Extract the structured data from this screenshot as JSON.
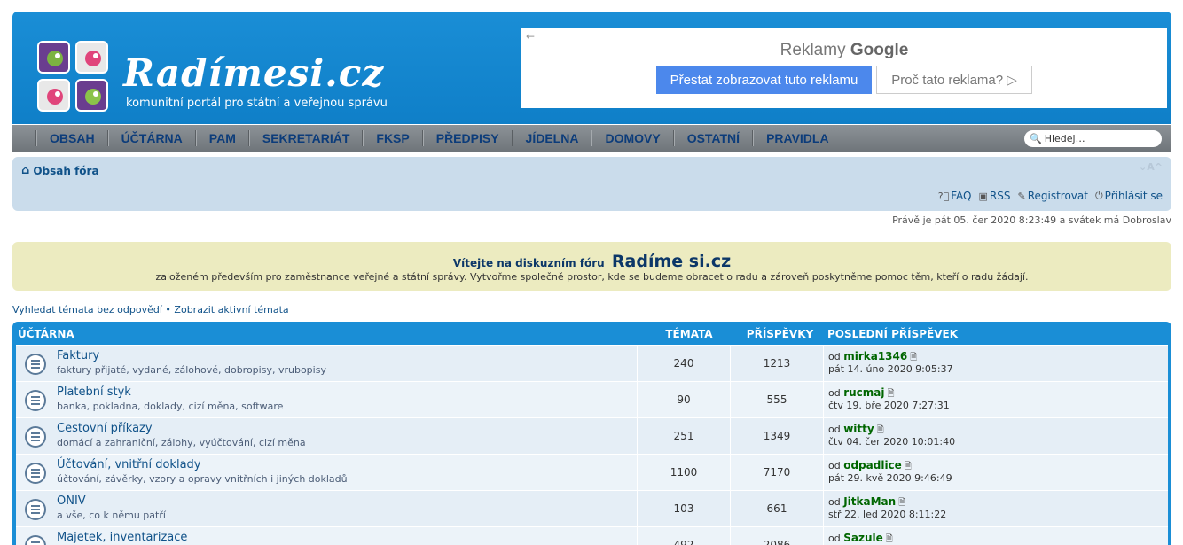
{
  "header": {
    "logo_title": "Radímesi.cz",
    "logo_subtitle": "komunitní portál pro státní a veřejnou správu"
  },
  "ad": {
    "back": "←",
    "title_prefix": "Reklamy",
    "title_brand": "Google",
    "stop_button": "Přestat zobrazovat tuto reklamu",
    "why_button": "Proč tato reklama? ▷"
  },
  "nav": {
    "items": [
      "OBSAH",
      "ÚČTÁRNA",
      "PAM",
      "SEKRETARIÁT",
      "FKSP",
      "PŘEDPISY",
      "JÍDELNA",
      "DOMOVY",
      "OSTATNÍ",
      "PRAVIDLA"
    ],
    "search_placeholder": "Hledej…"
  },
  "breadcrumb": {
    "home": "Obsah fóra",
    "font_size": "⌄A^",
    "links": {
      "faq": "FAQ",
      "rss": "RSS",
      "register": "Registrovat",
      "login": "Přihlásit se"
    }
  },
  "datetime": "Právě je pát 05. čer 2020 8:23:49 a svátek má Dobroslav",
  "welcome": {
    "line1_prefix": "Vítejte na diskuzním fóru",
    "line1_big": "Radíme si.cz",
    "line2": "založeném především pro zaměstnance veřejné a státní správy. Vytvořme společně prostor, kde se budeme obracet o radu a zároveň poskytněme pomoc těm, kteří o radu žádají."
  },
  "quicklinks": {
    "unanswered": "Vyhledat témata bez odpovědí",
    "sep": "•",
    "active": "Zobrazit aktivní témata"
  },
  "forum": {
    "title": "ÚČTÁRNA",
    "col_topics": "TÉMATA",
    "col_posts": "PŘÍSPĚVKY",
    "col_last": "POSLEDNÍ PŘÍSPĚVEK",
    "by_prefix": "od",
    "rows": [
      {
        "name": "Faktury",
        "desc": "faktury přijaté, vydané, zálohové, dobropisy, vrubopisy",
        "topics": "240",
        "posts": "1213",
        "user": "mirka1346",
        "when": "pát 14. úno 2020 9:05:37"
      },
      {
        "name": "Platební styk",
        "desc": "banka, pokladna, doklady, cizí měna, software",
        "topics": "90",
        "posts": "555",
        "user": "rucmaj",
        "when": "čtv 19. bře 2020 7:27:31"
      },
      {
        "name": "Cestovní příkazy",
        "desc": "domácí a zahraniční, zálohy, vyúčtování, cizí měna",
        "topics": "251",
        "posts": "1349",
        "user": "witty",
        "when": "čtv 04. čer 2020 10:01:40"
      },
      {
        "name": "Účtování, vnitřní doklady",
        "desc": "účtování, závěrky, vzory a opravy vnitřních i jiných dokladů",
        "topics": "1100",
        "posts": "7170",
        "user": "odpadlice",
        "when": "pát 29. kvě 2020 9:46:49"
      },
      {
        "name": "ONIV",
        "desc": "a vše, co k němu patří",
        "topics": "103",
        "posts": "661",
        "user": "JitkaMan",
        "when": "stř 22. led 2020 8:11:22"
      },
      {
        "name": "Majetek, inventarizace",
        "desc": "",
        "topics": "492",
        "posts": "2086",
        "user": "Sazule",
        "when": ""
      }
    ]
  }
}
